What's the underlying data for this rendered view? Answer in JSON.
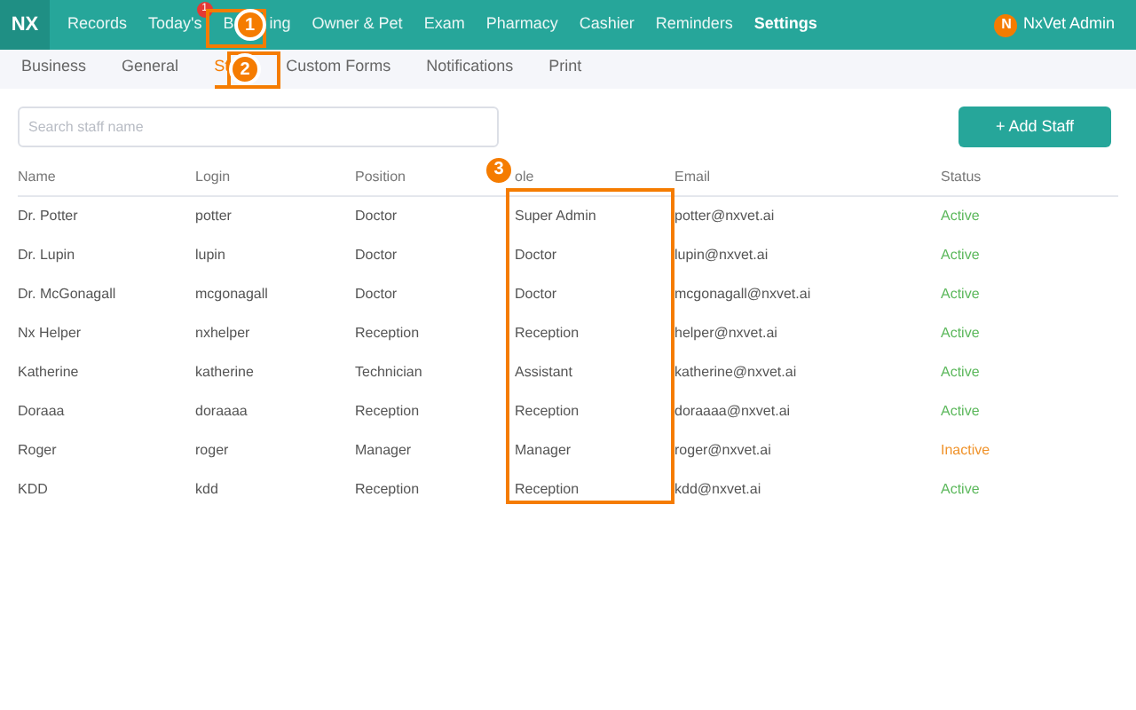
{
  "app": {
    "logo": "NX",
    "user": {
      "initial": "N",
      "name": "NxVet Admin"
    }
  },
  "nav": [
    {
      "label": "Records",
      "selected": false
    },
    {
      "label": "Today's",
      "selected": false,
      "badge": "1"
    },
    {
      "label": "B",
      "label_rest": "ing",
      "selected": false
    },
    {
      "label": "Owner & Pet",
      "selected": false
    },
    {
      "label": "Exam",
      "selected": false
    },
    {
      "label": "Pharmacy",
      "selected": false
    },
    {
      "label": "Cashier",
      "selected": false
    },
    {
      "label": "Reminders",
      "selected": false
    },
    {
      "label": "Settings",
      "selected": true
    }
  ],
  "subnav": [
    {
      "label": "Business",
      "selected": false
    },
    {
      "label": "General",
      "selected": false
    },
    {
      "label": "St",
      "selected": true
    },
    {
      "label": "Custom Forms",
      "selected": false
    },
    {
      "label": "Notifications",
      "selected": false
    },
    {
      "label": "Print",
      "selected": false
    }
  ],
  "search": {
    "placeholder": "Search staff name"
  },
  "add_button": "+ Add Staff",
  "table": {
    "columns": [
      "Name",
      "Login",
      "Position",
      "ole",
      "Email",
      "Status"
    ],
    "rows": [
      {
        "cells": [
          "Dr. Potter",
          "potter",
          "Doctor",
          "Super Admin",
          "potter@nxvet.ai"
        ],
        "status": "Active",
        "active": true
      },
      {
        "cells": [
          "Dr. Lupin",
          "lupin",
          "Doctor",
          "Doctor",
          "lupin@nxvet.ai"
        ],
        "status": "Active",
        "active": true
      },
      {
        "cells": [
          "Dr. McGonagall",
          "mcgonagall",
          "Doctor",
          "Doctor",
          "mcgonagall@nxvet.ai"
        ],
        "status": "Active",
        "active": true
      },
      {
        "cells": [
          "Nx Helper",
          "nxhelper",
          "Reception",
          "Reception",
          "helper@nxvet.ai"
        ],
        "status": "Active",
        "active": true
      },
      {
        "cells": [
          "Katherine",
          "katherine",
          "Technician",
          "Assistant",
          "katherine@nxvet.ai"
        ],
        "status": "Active",
        "active": true
      },
      {
        "cells": [
          "Doraaa",
          "doraaaa",
          "Reception",
          "Reception",
          "doraaaa@nxvet.ai"
        ],
        "status": "Active",
        "active": true
      },
      {
        "cells": [
          "Roger",
          "roger",
          "Manager",
          "Manager",
          "roger@nxvet.ai"
        ],
        "status": "Inactive",
        "active": false
      },
      {
        "cells": [
          "KDD",
          "kdd",
          "Reception",
          "Reception",
          "kdd@nxvet.ai"
        ],
        "status": "Active",
        "active": true
      }
    ]
  },
  "annotations": [
    {
      "number": "1"
    },
    {
      "number": "2"
    },
    {
      "number": "3"
    }
  ]
}
